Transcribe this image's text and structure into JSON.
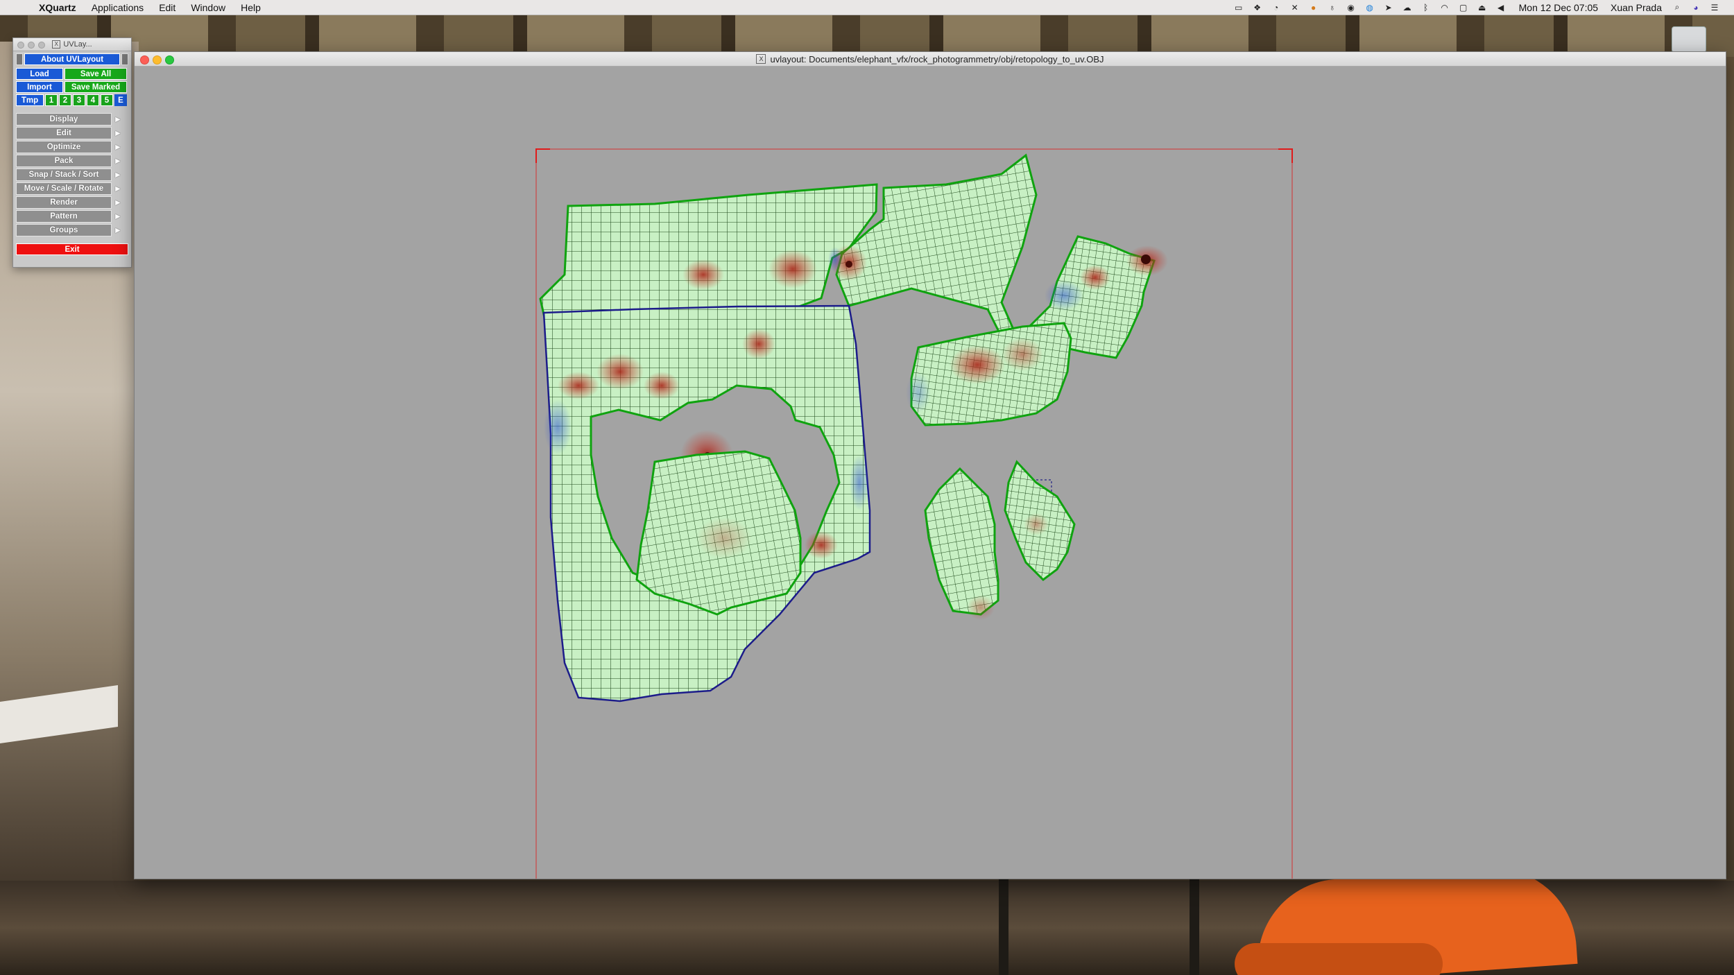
{
  "menubar": {
    "app": "XQuartz",
    "items": [
      "Applications",
      "Edit",
      "Window",
      "Help"
    ],
    "datetime": "Mon 12 Dec  07:05",
    "user": "Xuan Prada",
    "status_icons": [
      "dropbox-icon",
      "camera-icon",
      "evernote-icon",
      "tool-icon",
      "paint-icon",
      "lamp-icon",
      "ring-icon",
      "globe-icon",
      "sync-icon",
      "cloud-icon",
      "bluetooth-icon",
      "wifi-icon",
      "airplay-icon",
      "eject-icon",
      "volume-icon"
    ]
  },
  "palette": {
    "title": "UVLay...",
    "about": "About UVLayout",
    "load": "Load",
    "save_all": "Save All",
    "import": "Import",
    "save_marked": "Save Marked",
    "tmp": "Tmp",
    "slots": [
      "1",
      "2",
      "3",
      "4",
      "5",
      "E"
    ],
    "menu": [
      "Display",
      "Edit",
      "Optimize",
      "Pack",
      "Snap / Stack / Sort",
      "Move / Scale / Rotate",
      "Render",
      "Pattern",
      "Groups"
    ],
    "exit": "Exit"
  },
  "window": {
    "title": "uvlayout: Documents/elephant_vfx/rock_photogrammetry/obj/retopology_to_uv.OBJ"
  },
  "colors": {
    "shell_fill": "#c8f0c4",
    "shell_stroke": "#0fa30f",
    "selected_stroke": "#1c1c8a",
    "frame": "#e01b1b",
    "viewport_bg": "#a3a3a3",
    "distortion": "#c0392b"
  }
}
